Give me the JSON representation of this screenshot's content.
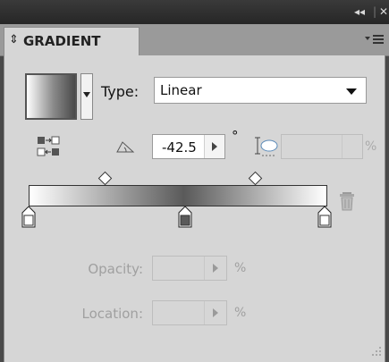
{
  "window": {
    "collapse_glyph": "◂◂",
    "close_glyph": "✕"
  },
  "panel": {
    "title": "GRADIENT",
    "menu_icon": "panel-menu-icon"
  },
  "gradient": {
    "type_label": "Type:",
    "type_value": "Linear",
    "angle_value": "-42.5",
    "angle_unit": "°",
    "aspect_unit": "%",
    "colors": {
      "start": "#ffffff",
      "mid": "#5a5a5a",
      "end": "#ffffff"
    }
  },
  "stop_settings": {
    "opacity_label": "Opacity:",
    "opacity_unit": "%",
    "location_label": "Location:",
    "location_unit": "%"
  }
}
